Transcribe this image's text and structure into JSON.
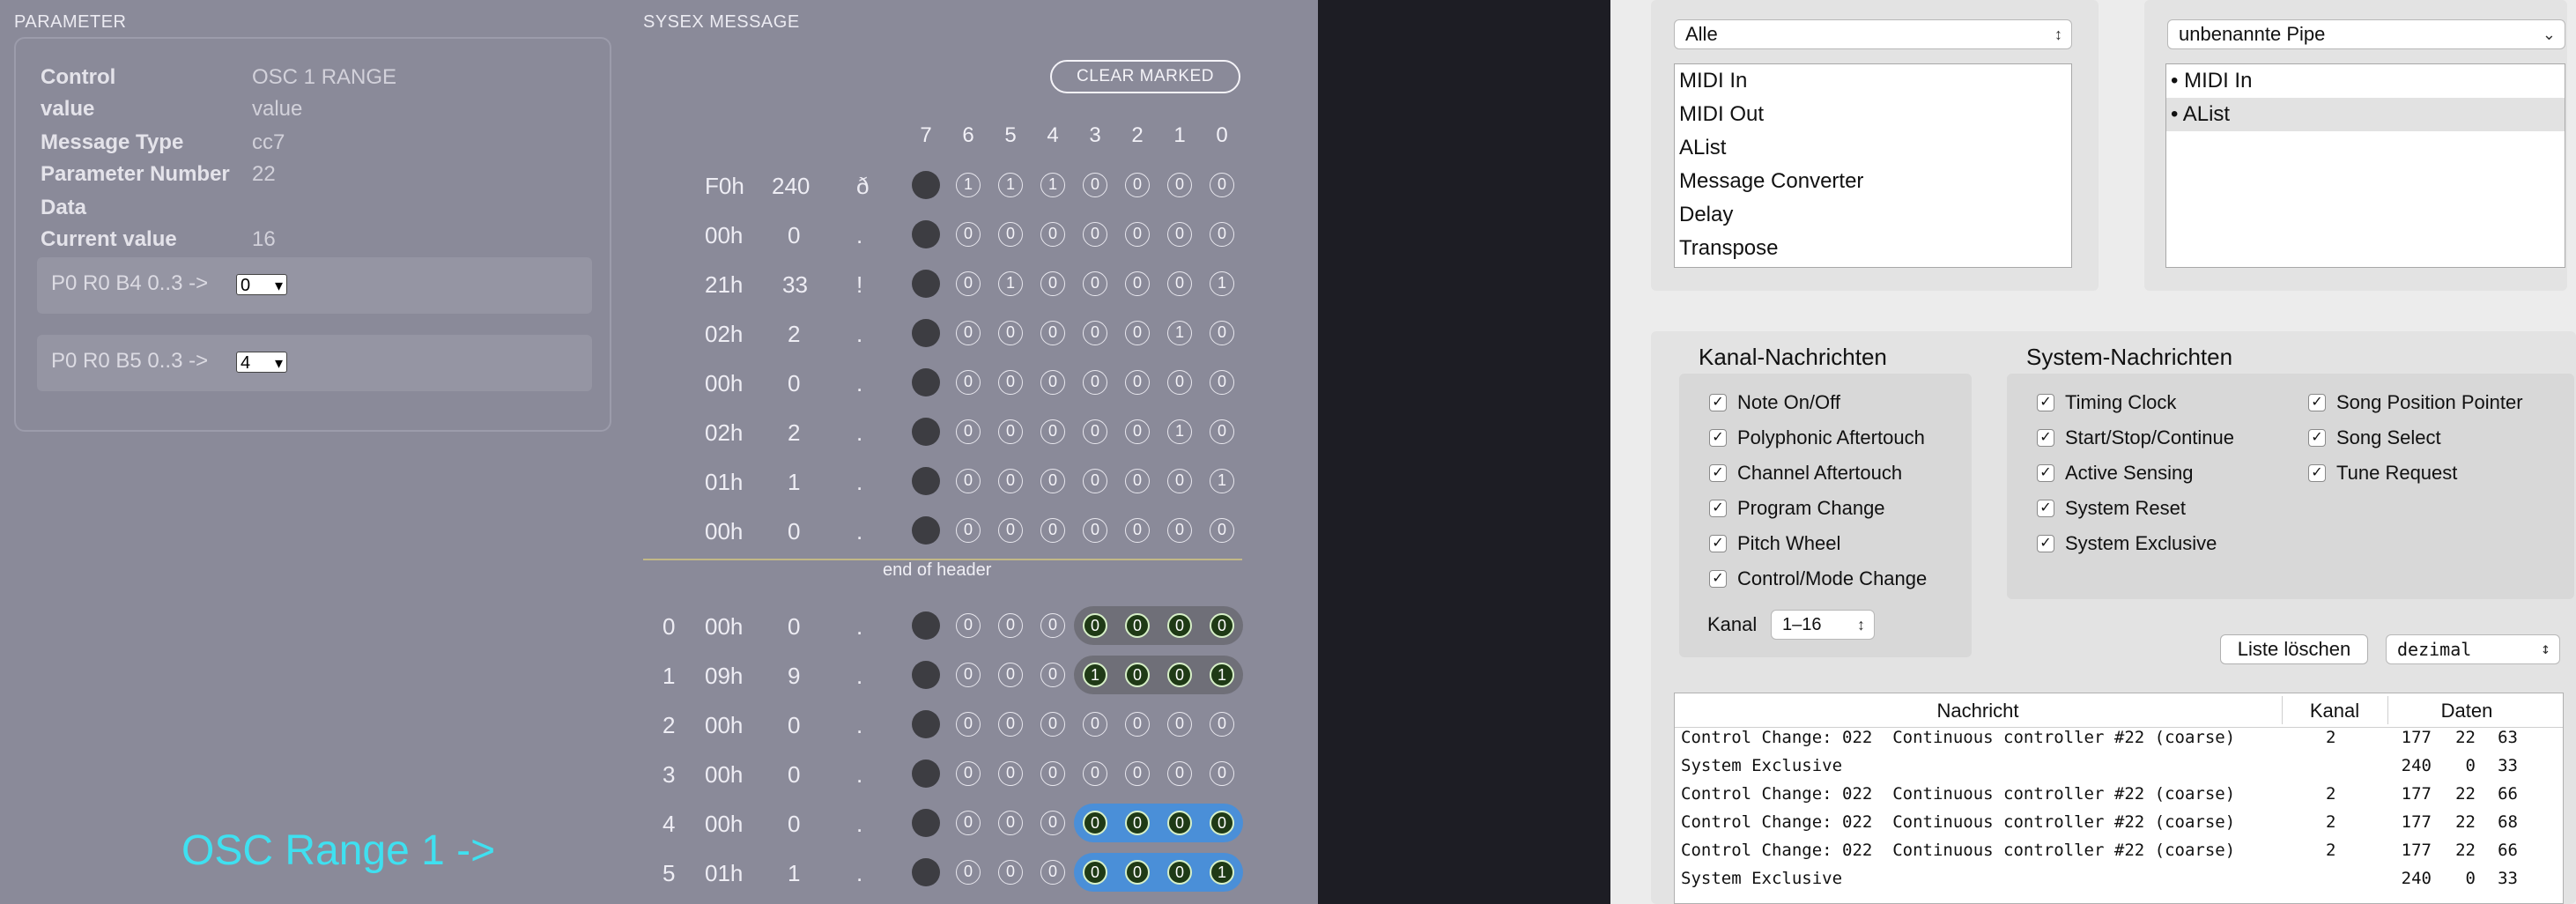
{
  "parameter": {
    "title": "PARAMETER",
    "rows": [
      {
        "label": "Control",
        "value": "OSC 1 RANGE"
      },
      {
        "label": "value",
        "value": "value"
      },
      {
        "label": "Message Type",
        "value": "cc7"
      },
      {
        "label": "Parameter Number",
        "value": "22"
      },
      {
        "label": "Data",
        "value": ""
      },
      {
        "label": "Current value",
        "value": "16"
      }
    ],
    "selects": [
      {
        "label": "P0 R0 B4 0..3 ->",
        "selected": "0"
      },
      {
        "label": "P0 R0 B5 0..3 ->",
        "selected": "4"
      }
    ]
  },
  "sysex": {
    "title": "SYSEX MESSAGE",
    "clear_label": "CLEAR MARKED",
    "bit_headers": [
      "7",
      "6",
      "5",
      "4",
      "3",
      "2",
      "1",
      "0"
    ],
    "header_rows": [
      {
        "hex": "F0h",
        "dec": "240",
        "chr": "ð",
        "bits": [
          "1",
          "1",
          "1",
          "0",
          "0",
          "0",
          "0"
        ]
      },
      {
        "hex": "00h",
        "dec": "0",
        "chr": ".",
        "bits": [
          "0",
          "0",
          "0",
          "0",
          "0",
          "0",
          "0"
        ]
      },
      {
        "hex": "21h",
        "dec": "33",
        "chr": "!",
        "bits": [
          "0",
          "1",
          "0",
          "0",
          "0",
          "0",
          "1"
        ]
      },
      {
        "hex": "02h",
        "dec": "2",
        "chr": ".",
        "bits": [
          "0",
          "0",
          "0",
          "0",
          "0",
          "1",
          "0"
        ]
      },
      {
        "hex": "00h",
        "dec": "0",
        "chr": ".",
        "bits": [
          "0",
          "0",
          "0",
          "0",
          "0",
          "0",
          "0"
        ]
      },
      {
        "hex": "02h",
        "dec": "2",
        "chr": ".",
        "bits": [
          "0",
          "0",
          "0",
          "0",
          "0",
          "1",
          "0"
        ]
      },
      {
        "hex": "01h",
        "dec": "1",
        "chr": ".",
        "bits": [
          "0",
          "0",
          "0",
          "0",
          "0",
          "0",
          "1"
        ]
      },
      {
        "hex": "00h",
        "dec": "0",
        "chr": ".",
        "bits": [
          "0",
          "0",
          "0",
          "0",
          "0",
          "0",
          "0"
        ]
      }
    ],
    "end_of_header": "end of header",
    "data_rows": [
      {
        "idx": "0",
        "hex": "00h",
        "dec": "0",
        "chr": ".",
        "bits": [
          "0",
          "0",
          "0",
          "0",
          "0",
          "0",
          "0"
        ],
        "mark": "gray"
      },
      {
        "idx": "1",
        "hex": "09h",
        "dec": "9",
        "chr": ".",
        "bits": [
          "0",
          "0",
          "0",
          "1",
          "0",
          "0",
          "1"
        ],
        "mark": "gray"
      },
      {
        "idx": "2",
        "hex": "00h",
        "dec": "0",
        "chr": ".",
        "bits": [
          "0",
          "0",
          "0",
          "0",
          "0",
          "0",
          "0"
        ],
        "mark": "none"
      },
      {
        "idx": "3",
        "hex": "00h",
        "dec": "0",
        "chr": ".",
        "bits": [
          "0",
          "0",
          "0",
          "0",
          "0",
          "0",
          "0"
        ],
        "mark": "none"
      },
      {
        "idx": "4",
        "hex": "00h",
        "dec": "0",
        "chr": ".",
        "bits": [
          "0",
          "0",
          "0",
          "0",
          "0",
          "0",
          "0"
        ],
        "mark": "blue"
      },
      {
        "idx": "5",
        "hex": "01h",
        "dec": "1",
        "chr": ".",
        "bits": [
          "0",
          "0",
          "0",
          "0",
          "0",
          "0",
          "1"
        ],
        "mark": "blue"
      }
    ]
  },
  "osc_label": "OSC Range 1   ->",
  "midi": {
    "source_popup": "Alle",
    "source_list": [
      "MIDI In",
      "MIDI Out",
      "AList",
      "Message Converter",
      "Delay",
      "Transpose"
    ],
    "pipe_popup": "unbenannte Pipe",
    "pipe_list": [
      "• MIDI In",
      "• AList"
    ],
    "channel_title": "Kanal-Nachrichten",
    "channel_items": [
      "Note On/Off",
      "Polyphonic Aftertouch",
      "Channel Aftertouch",
      "Program Change",
      "Pitch Wheel",
      "Control/Mode Change"
    ],
    "kanal_label": "Kanal",
    "kanal_value": "1–16",
    "system_title": "System-Nachrichten",
    "system_items_a": [
      "Timing Clock",
      "Start/Stop/Continue",
      "Active Sensing",
      "System Reset",
      "System Exclusive"
    ],
    "system_items_b": [
      "Song Position Pointer",
      "Song Select",
      "Tune Request"
    ],
    "check_mark": "✓",
    "clear_list": "Liste löschen",
    "format_popup": "dezimal",
    "log_headers": {
      "msg": "Nachricht",
      "kanal": "Kanal",
      "daten": "Daten"
    },
    "log_rows": [
      {
        "msg": "Control Change: 022  Continuous controller #22 (coarse)",
        "kanal": "2",
        "d1": "177",
        "d2": "22",
        "d3": "63"
      },
      {
        "msg": "System Exclusive",
        "kanal": "",
        "d1": "240",
        "d2": "0",
        "d3": "33"
      },
      {
        "msg": "Control Change: 022  Continuous controller #22 (coarse)",
        "kanal": "2",
        "d1": "177",
        "d2": "22",
        "d3": "66"
      },
      {
        "msg": "Control Change: 022  Continuous controller #22 (coarse)",
        "kanal": "2",
        "d1": "177",
        "d2": "22",
        "d3": "68"
      },
      {
        "msg": "Control Change: 022  Continuous controller #22 (coarse)",
        "kanal": "2",
        "d1": "177",
        "d2": "22",
        "d3": "66"
      },
      {
        "msg": "System Exclusive",
        "kanal": "",
        "d1": "240",
        "d2": "0",
        "d3": "33"
      }
    ]
  }
}
